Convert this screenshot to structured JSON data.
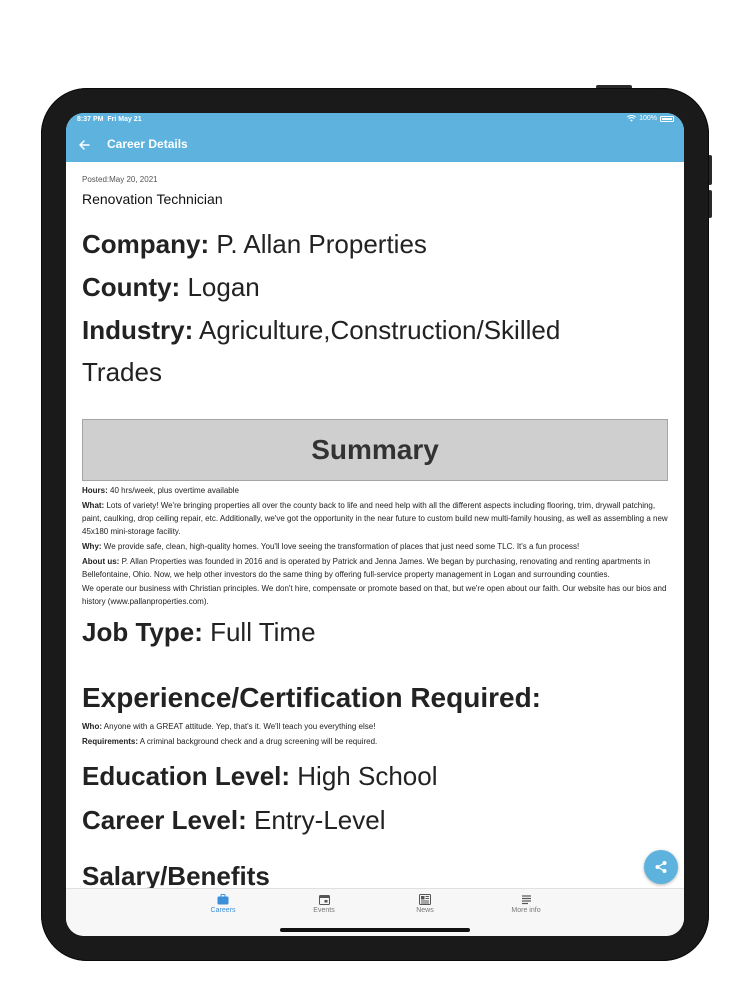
{
  "status_bar": {
    "time": "8:37 PM",
    "date": "Fri May 21",
    "battery": "100%"
  },
  "nav": {
    "title": "Career Details"
  },
  "job": {
    "posted": "Posted:May 20, 2021",
    "title": "Renovation Technician",
    "company_label": "Company:",
    "company": "P. Allan Properties",
    "county_label": "County:",
    "county": "Logan",
    "industry_label": "Industry:",
    "industry": "Agriculture,Construction/Skilled Trades"
  },
  "summary": {
    "heading": "Summary",
    "hours_label": "Hours:",
    "hours": "40 hrs/week, plus overtime available",
    "what_label": "What:",
    "what": "Lots of variety! We're bringing properties all over the county back to life and need help with all the different aspects including flooring, trim, drywall patching, paint, caulking, drop ceiling repair, etc. Additionally, we've got the opportunity in the near future to custom build new multi-family housing, as well as assembling a new 45x180 mini-storage facility.",
    "why_label": "Why:",
    "why": "We provide safe, clean, high-quality homes. You'll love seeing the transformation of places that just need some TLC. It's a fun process!",
    "about_label": "About us:",
    "about": "P. Allan Properties was founded in 2016 and is operated by Patrick and Jenna James. We began by purchasing, renovating and renting apartments in Bellefontaine, Ohio. Now, we help other investors do the same thing by offering full-service property management in Logan and surrounding counties.",
    "faith": "We operate our business with Christian principles. We don't hire, compensate or promote based on that, but we're open about our faith. Our website has our bios and history (www.pallanproperties.com)."
  },
  "job_type": {
    "label": "Job Type:",
    "value": "Full Time"
  },
  "experience": {
    "heading": "Experience/Certification Required:",
    "who_label": "Who:",
    "who": "Anyone with a GREAT attitude. Yep, that's it. We'll teach you everything else!",
    "req_label": "Requirements:",
    "req": "A criminal background check and a drug screening will be required."
  },
  "education": {
    "label": "Education Level:",
    "value": "High School"
  },
  "career": {
    "label": "Career Level:",
    "value": "Entry-Level"
  },
  "salary": {
    "heading": "Salary/Benefits"
  },
  "tabs": [
    {
      "label": "Careers",
      "icon": "briefcase-icon",
      "active": true
    },
    {
      "label": "Events",
      "icon": "calendar-icon",
      "active": false
    },
    {
      "label": "News",
      "icon": "newspaper-icon",
      "active": false
    },
    {
      "label": "More info",
      "icon": "list-icon",
      "active": false
    }
  ],
  "colors": {
    "accent": "#5eb2de",
    "tab_active": "#3b8fd9",
    "summary_bg": "#cfcfcf"
  }
}
